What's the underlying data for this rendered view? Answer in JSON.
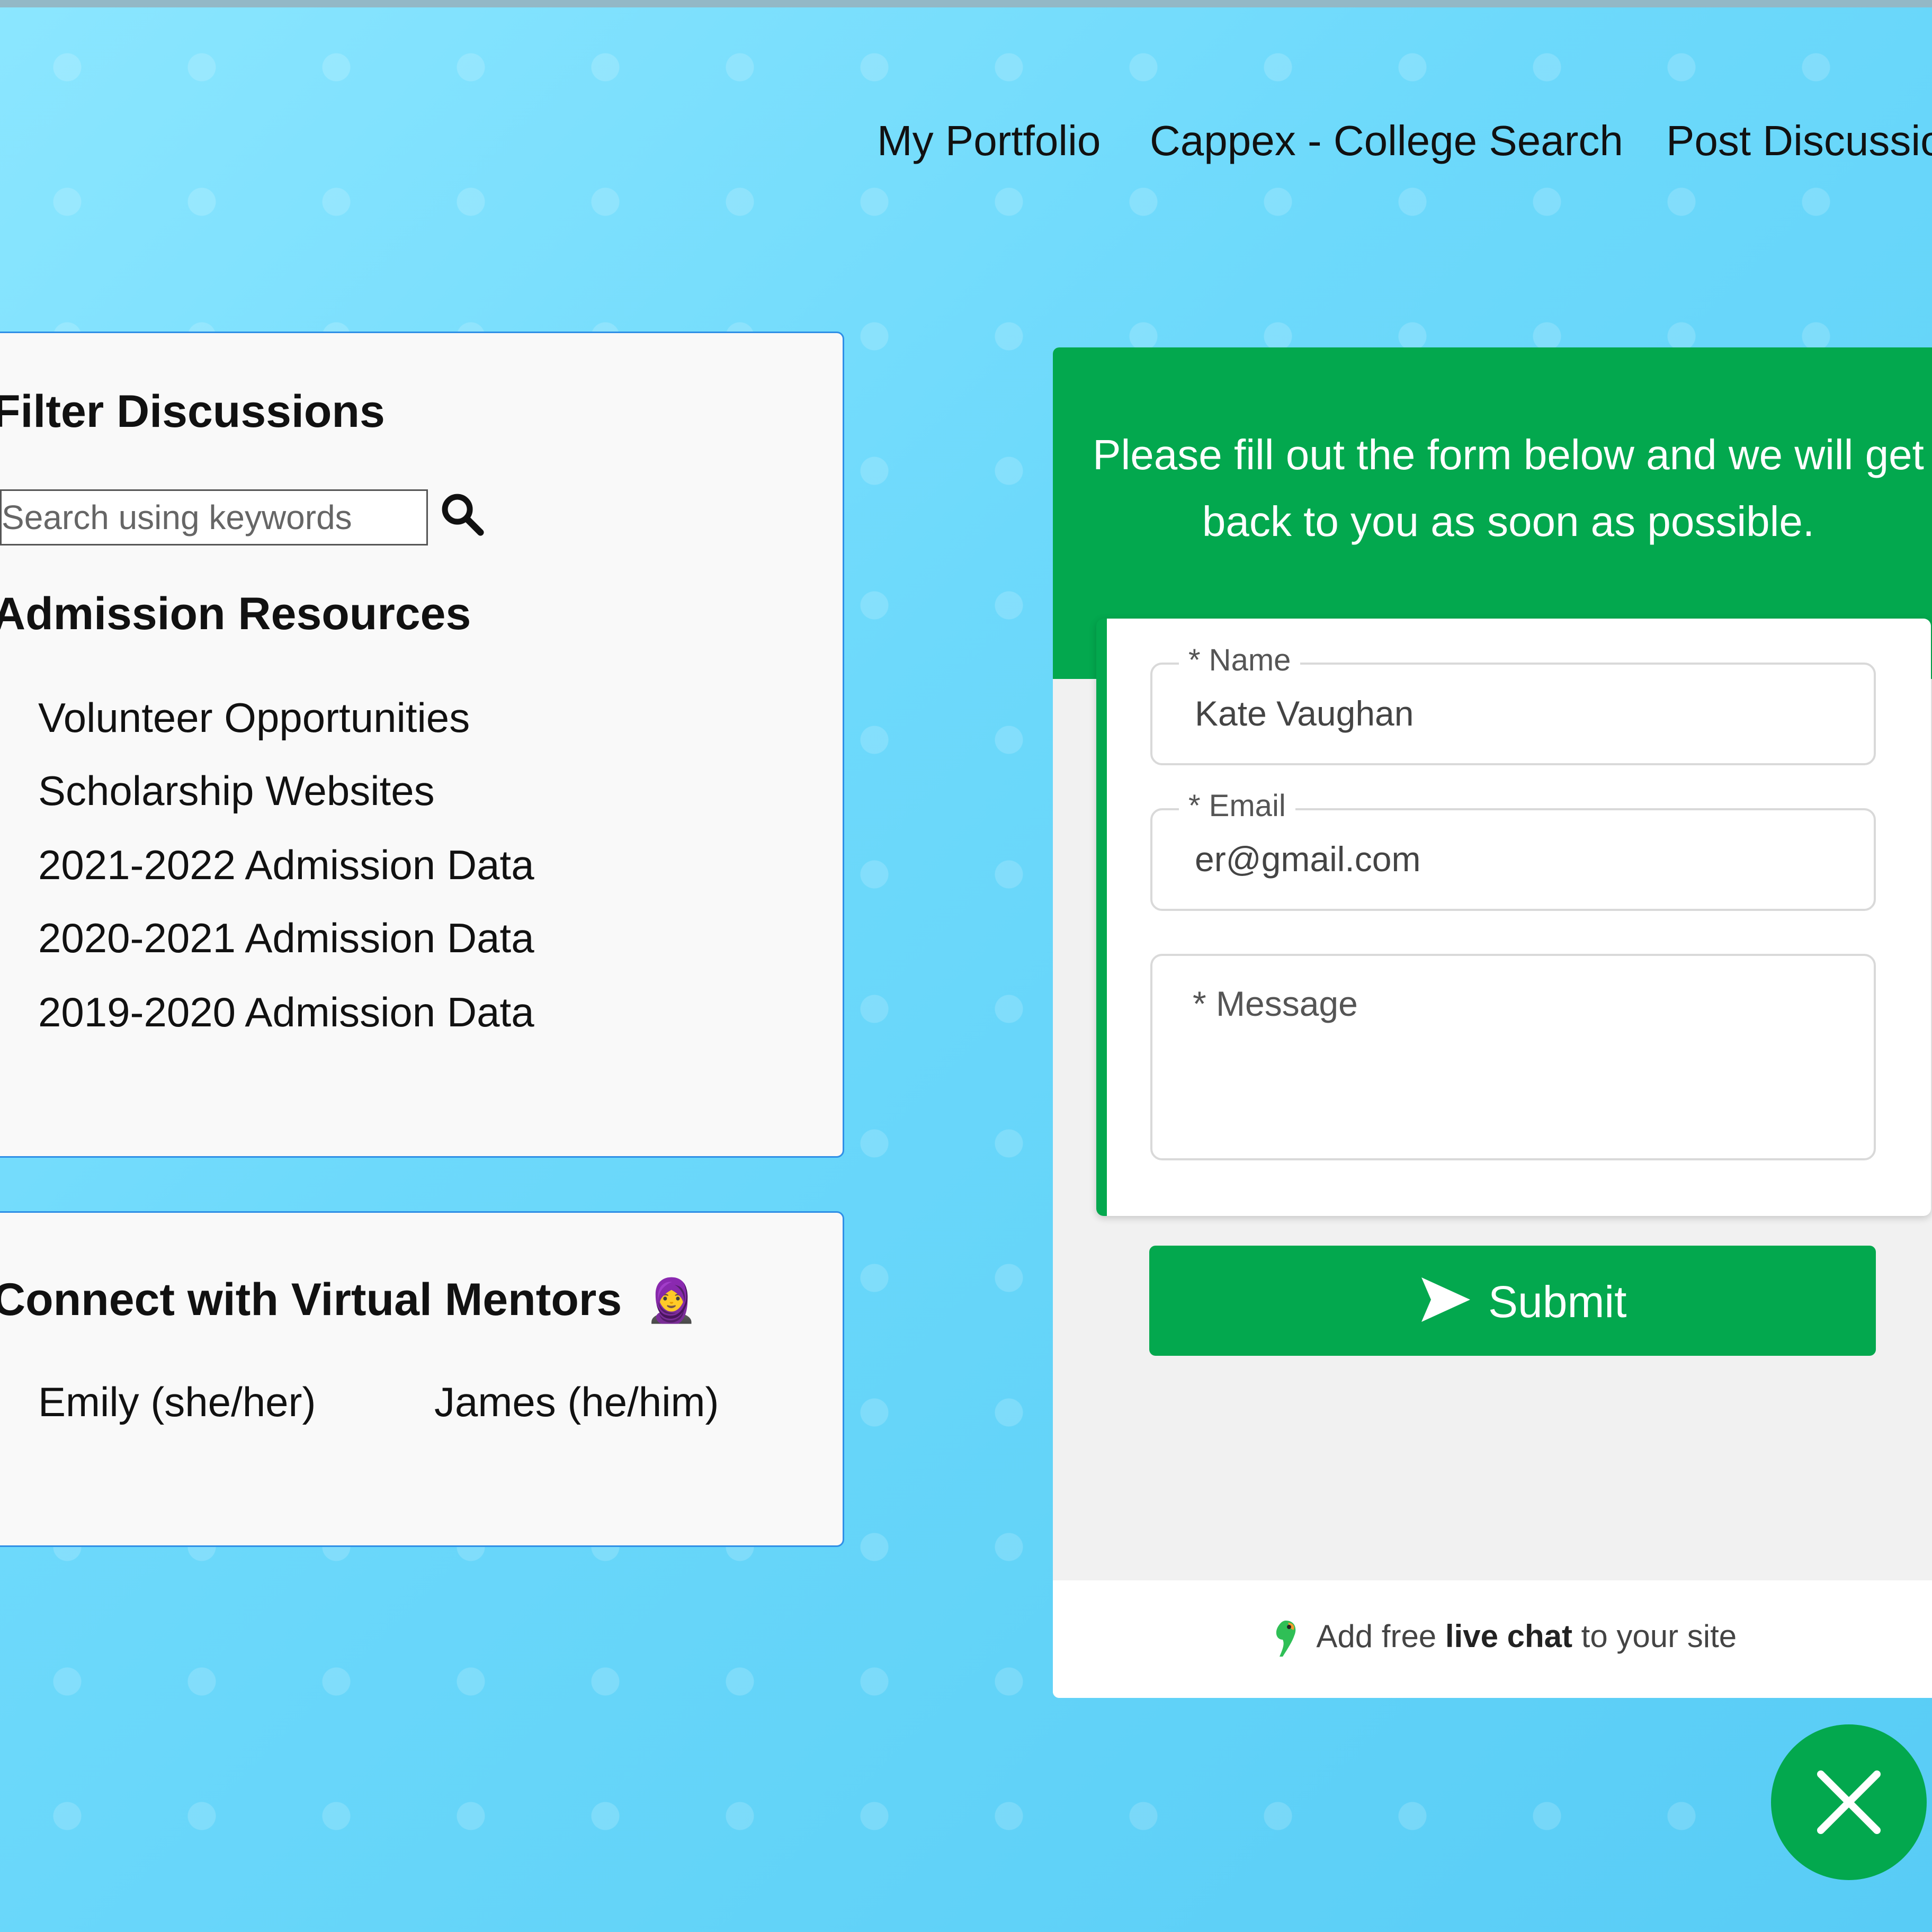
{
  "nav": {
    "items": [
      "My Portfolio",
      "Cappex - College Search",
      "Post Discussion"
    ]
  },
  "filter": {
    "title": "Filter Discussions",
    "search_placeholder": "Search using keywords",
    "resources_title": "Admission Resources",
    "resources": [
      "Volunteer Opportunities",
      "Scholarship Websites",
      "2021-2022 Admission Data",
      "2020-2021 Admission Data",
      "2019-2020 Admission Data"
    ]
  },
  "mentors": {
    "title": "Connect with Virtual Mentors",
    "emoji": "🧕",
    "people": [
      "Emily (she/her)",
      "James (he/him)"
    ]
  },
  "chat": {
    "message": "Please fill out the form below and we will get back to you as soon as possible.",
    "name_label": "* Name",
    "name_value": "Kate Vaughan",
    "email_label": "* Email",
    "email_value": "er@gmail.com",
    "message_placeholder": "* Message",
    "submit_label": "Submit",
    "footer_pre": "Add free",
    "footer_bold": "live chat",
    "footer_post": "to your site",
    "accent": "#03a84e"
  }
}
